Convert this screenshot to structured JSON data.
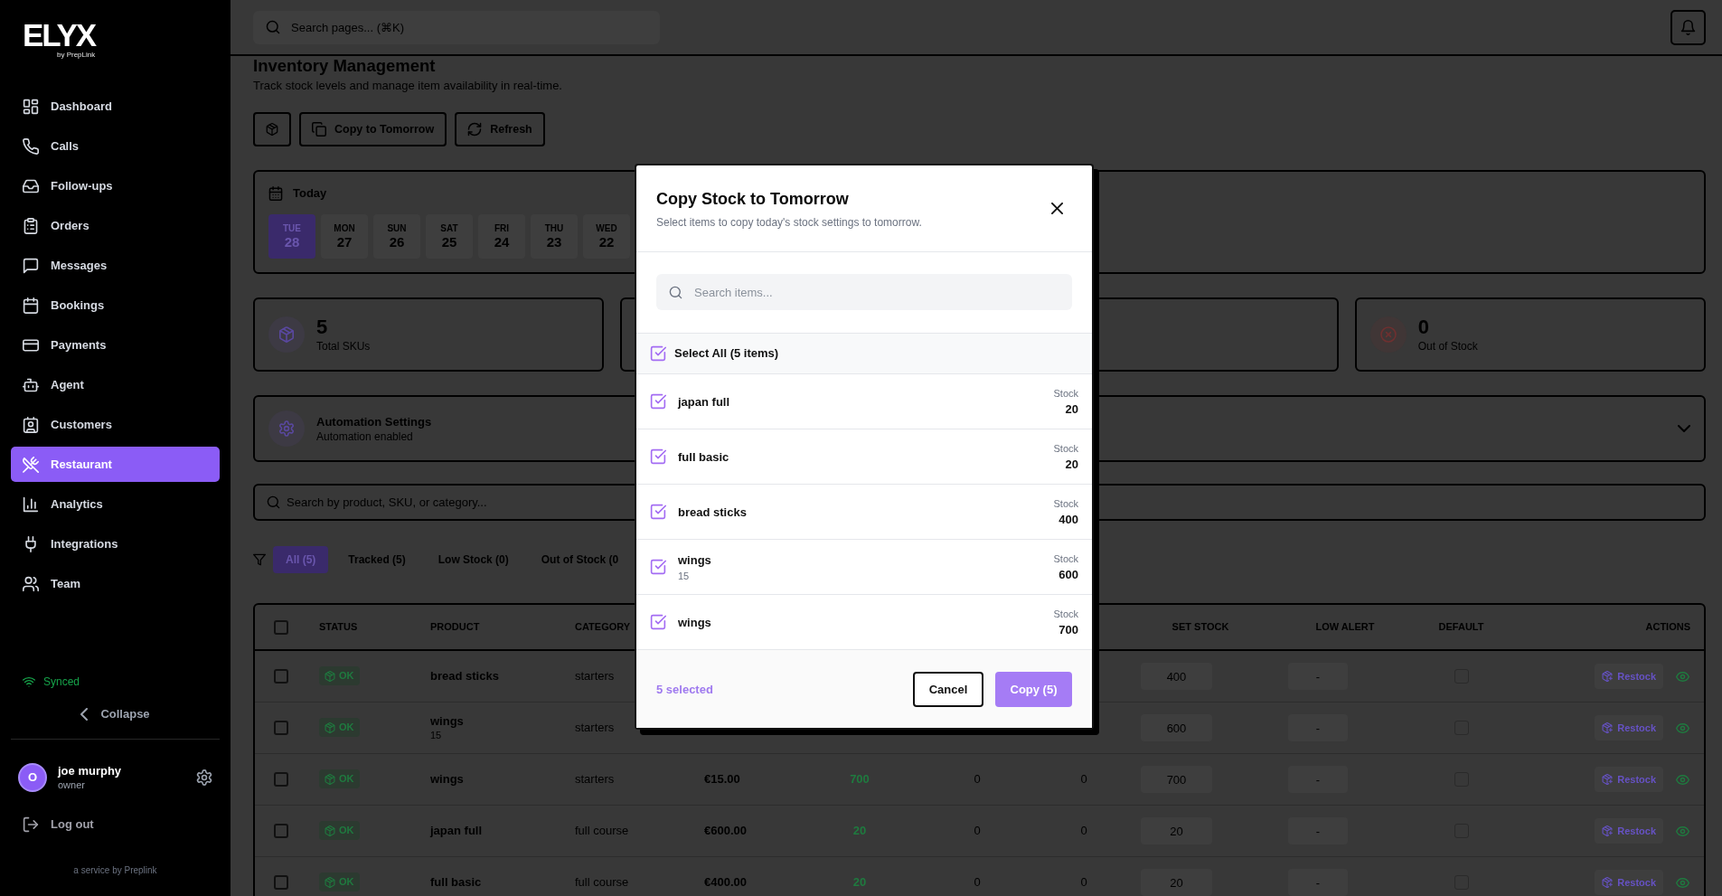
{
  "sidebar": {
    "logo": {
      "wordmark": "ELYX",
      "tagline": "by PrepLink"
    },
    "nav": [
      {
        "label": "Dashboard",
        "selected": false
      },
      {
        "label": "Calls",
        "selected": false
      },
      {
        "label": "Follow-ups",
        "selected": false
      },
      {
        "label": "Orders",
        "selected": false
      },
      {
        "label": "Messages",
        "selected": false
      },
      {
        "label": "Bookings",
        "selected": false
      },
      {
        "label": "Payments",
        "selected": false
      },
      {
        "label": "Agent",
        "selected": false
      },
      {
        "label": "Customers",
        "selected": false
      },
      {
        "label": "Restaurant",
        "selected": true
      },
      {
        "label": "Analytics",
        "selected": false
      },
      {
        "label": "Integrations",
        "selected": false
      },
      {
        "label": "Team",
        "selected": false
      }
    ],
    "sync_status": "Synced",
    "collapse": "Collapse",
    "user": {
      "initial": "O",
      "name": "joe murphy",
      "role": "owner"
    },
    "logout": "Log out",
    "footer": "a service by Preplink"
  },
  "topbar": {
    "search": {
      "placeholder": "Search pages... (⌘K)"
    }
  },
  "page": {
    "title": "Inventory Management",
    "subtitle": "Track stock levels and manage item availability in real-time.",
    "actions": [
      "Copy to Tomorrow",
      "Refresh"
    ]
  },
  "date_picker": {
    "label": "Today",
    "days": [
      {
        "weekday": "TUE",
        "day": "28",
        "selected": true
      },
      {
        "weekday": "MON",
        "day": "27",
        "selected": false
      },
      {
        "weekday": "SUN",
        "day": "26",
        "selected": false
      },
      {
        "weekday": "SAT",
        "day": "25",
        "selected": false
      },
      {
        "weekday": "FRI",
        "day": "24",
        "selected": false
      },
      {
        "weekday": "THU",
        "day": "23",
        "selected": false
      },
      {
        "weekday": "WED",
        "day": "22",
        "selected": false
      }
    ]
  },
  "stats": [
    {
      "kind": "total",
      "value": "5",
      "label": "Total SKUs"
    },
    {
      "kind": "covered"
    },
    {
      "kind": "covered"
    },
    {
      "kind": "out_of_stock",
      "value": "0",
      "label": "Out of Stock"
    }
  ],
  "automation": {
    "title": "Automation Settings",
    "status": "Automation enabled",
    "expanded": false
  },
  "inventory_search": {
    "placeholder": "Search by product, SKU, or category..."
  },
  "filters": [
    {
      "label": "All (5)",
      "selected": true
    },
    {
      "label": "Tracked (5)",
      "selected": false
    },
    {
      "label": "Low Stock (0)",
      "selected": false
    },
    {
      "label": "Out of Stock (0",
      "selected": false
    }
  ],
  "table": {
    "select_all_checked": false,
    "columns": {
      "status": "STATUS",
      "product": "PRODUCT",
      "category": "CATEGORY",
      "set_stock": "SET STOCK",
      "low_alert": "LOW ALERT",
      "default": "DEFAULT",
      "actions": "ACTIONS"
    },
    "rows": [
      {
        "checked": false,
        "status": "OK",
        "product": "bread sticks",
        "category": "starters",
        "set_stock": "400",
        "low_alert": "-",
        "default_checked": false,
        "action": "Restock"
      },
      {
        "checked": false,
        "status": "OK",
        "product": "wings",
        "detail": "15",
        "category": "starters",
        "set_stock": "600",
        "low_alert": "-",
        "default_checked": false,
        "action": "Restock"
      },
      {
        "checked": false,
        "status": "OK",
        "product": "wings",
        "category": "starters",
        "column_5": "€15.00",
        "column_6": "700",
        "column_7": "0",
        "column_8": "0",
        "set_stock": "700",
        "low_alert": "-",
        "default_checked": false,
        "action": "Restock"
      },
      {
        "checked": false,
        "status": "OK",
        "product": "japan full",
        "category": "full course",
        "column_5": "€600.00",
        "column_6": "20",
        "column_7": "0",
        "column_8": "0",
        "set_stock": "20",
        "low_alert": "-",
        "default_checked": false,
        "action": "Restock"
      },
      {
        "checked": false,
        "status": "OK",
        "product": "full basic",
        "category": "full course",
        "column_5": "€400.00",
        "column_6": "20",
        "column_7": "0",
        "column_8": "0",
        "set_stock": "20",
        "low_alert": "-",
        "default_checked": false,
        "action": "Restock"
      }
    ]
  },
  "modal": {
    "title": "Copy Stock to Tomorrow",
    "subtitle": "Select items to copy today's stock settings to tomorrow.",
    "search": {
      "placeholder": "Search items..."
    },
    "select_all": {
      "label": "Select All (5 items)",
      "checked": true
    },
    "items": [
      {
        "name": "japan full",
        "stock_label": "Stock",
        "stock": "20",
        "checked": true
      },
      {
        "name": "full basic",
        "stock_label": "Stock",
        "stock": "20",
        "checked": true
      },
      {
        "name": "bread sticks",
        "stock_label": "Stock",
        "stock": "400",
        "checked": true
      },
      {
        "name": "wings",
        "detail": "15",
        "stock_label": "Stock",
        "stock": "600",
        "checked": true
      },
      {
        "name": "wings",
        "stock_label": "Stock",
        "stock": "700",
        "checked": true
      }
    ],
    "selection_count": "5 selected",
    "buttons": {
      "cancel": "Cancel",
      "confirm": "Copy (5)"
    }
  }
}
